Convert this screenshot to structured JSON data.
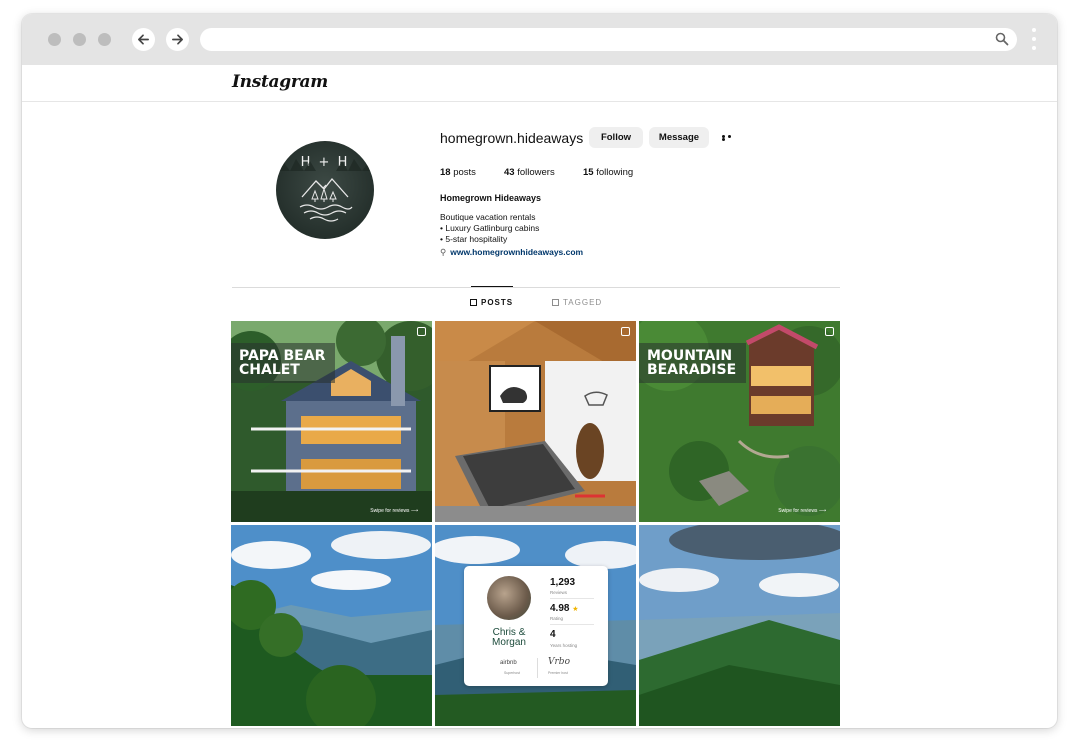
{
  "browser": {
    "window_dots": [
      "close",
      "minimize",
      "maximize"
    ],
    "url": ""
  },
  "app": {
    "logo": "Instagram"
  },
  "profile": {
    "username": "homegrown.hideaways",
    "follow_label": "Follow",
    "message_label": "Message",
    "stats": {
      "posts_count": "18",
      "posts_label": "posts",
      "followers_count": "43",
      "followers_label": "followers",
      "following_count": "15",
      "following_label": "following"
    },
    "full_name": "Homegrown Hideaways",
    "bio_lines": [
      "Boutique vacation rentals",
      "• Luxury Gatlinburg cabins",
      "• 5-star hospitality"
    ],
    "website": "www.homegrownhideaways.com",
    "avatar_letters": "H + H"
  },
  "tabs": [
    {
      "label": "POSTS",
      "active": true
    },
    {
      "label": "TAGGED",
      "active": false
    }
  ],
  "posts": [
    {
      "caption_line1": "PAPA BEAR",
      "caption_line2": "CHALET",
      "swipe_text": "Swipe for reviews ⟶"
    },
    {},
    {
      "caption_line1": "MOUNTAIN",
      "caption_line2": "BEARADISE",
      "swipe_text": "Swipe for reviews ⟶"
    },
    {},
    {
      "card": {
        "names_line1": "Chris &",
        "names_line2": "Morgan",
        "reviews_value": "1,293",
        "reviews_label": "Reviews",
        "rating_value": "4.98",
        "rating_label": "Rating",
        "years_value": "4",
        "years_label": "Years hosting",
        "brand1": "airbnb",
        "brand1_sub": "Superhost",
        "brand2": "Vrbo",
        "brand2_sub": "Premier host"
      }
    },
    {}
  ],
  "colors": {
    "chrome_bg": "#e4e4e4",
    "link": "#00376b",
    "button_bg": "#efefef",
    "card_name": "#1d4c3c",
    "star": "#f0b400"
  },
  "icons": [
    "back-arrow-icon",
    "forward-arrow-icon",
    "search-icon",
    "kebab-menu-icon",
    "more-options-icon",
    "link-icon",
    "grid-icon",
    "tagged-icon",
    "multiple-photos-icon",
    "star-icon"
  ]
}
